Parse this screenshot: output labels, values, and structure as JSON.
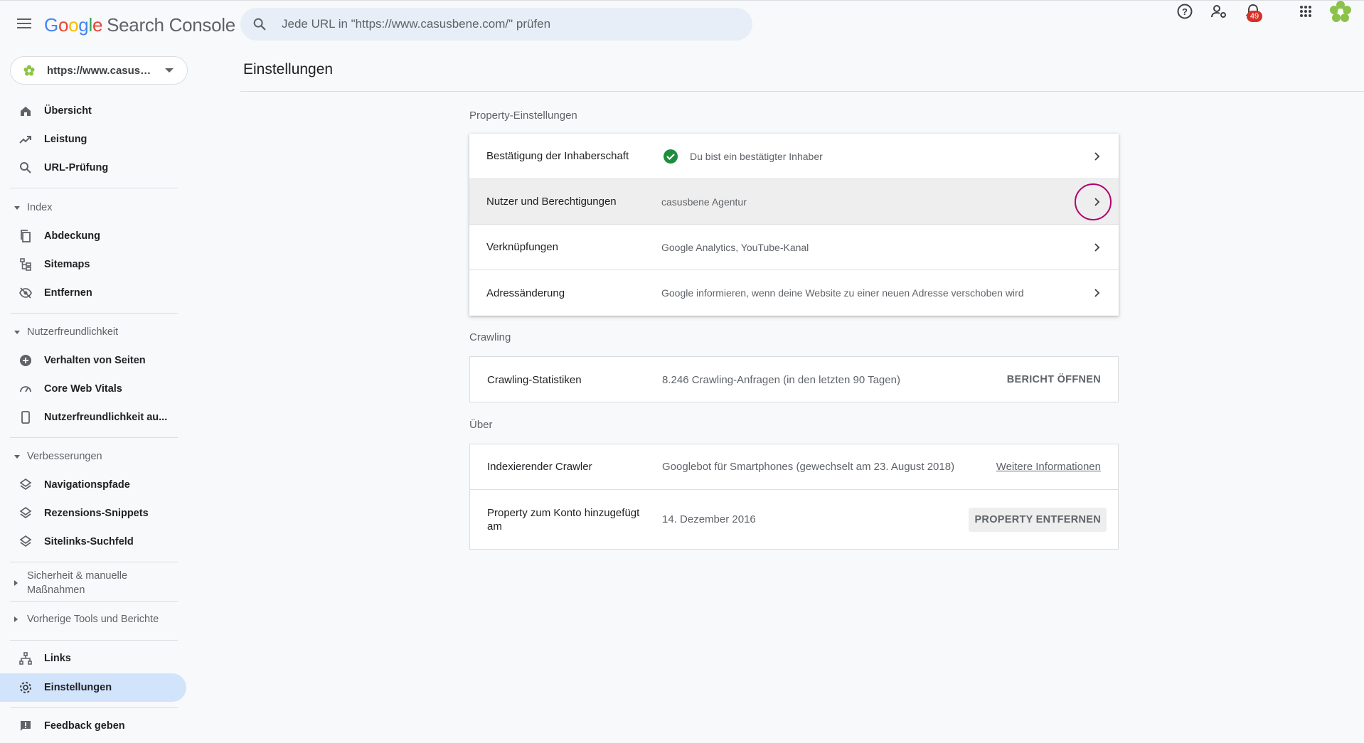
{
  "header": {
    "logo_google": [
      "G",
      "o",
      "o",
      "g",
      "l",
      "e"
    ],
    "product_name": "Search Console",
    "search_placeholder": "Jede URL in \"https://www.casusbene.com/\" prüfen",
    "notification_count": "49"
  },
  "sidebar": {
    "property": "https://www.casusbene.com/",
    "items_top": [
      {
        "label": "Übersicht",
        "icon": "home-icon"
      },
      {
        "label": "Leistung",
        "icon": "trending-up-icon"
      },
      {
        "label": "URL-Prüfung",
        "icon": "search-icon"
      }
    ],
    "group_index": "Index",
    "items_index": [
      {
        "label": "Abdeckung",
        "icon": "file-copy-icon"
      },
      {
        "label": "Sitemaps",
        "icon": "sitemap-icon"
      },
      {
        "label": "Entfernen",
        "icon": "visibility-off-icon"
      }
    ],
    "group_usability": "Nutzerfreundlichkeit",
    "items_usability": [
      {
        "label": "Verhalten von Seiten",
        "icon": "add-circle-icon"
      },
      {
        "label": "Core Web Vitals",
        "icon": "speed-icon"
      },
      {
        "label": "Nutzerfreundlichkeit au...",
        "icon": "smartphone-icon"
      }
    ],
    "group_enhancements": "Verbesserungen",
    "items_enhancements": [
      {
        "label": "Navigationspfade",
        "icon": "layers-icon"
      },
      {
        "label": "Rezensions-Snippets",
        "icon": "layers-icon"
      },
      {
        "label": "Sitelinks-Suchfeld",
        "icon": "layers-icon"
      }
    ],
    "group_security": "Sicherheit & manuelle Maßnahmen",
    "group_legacy": "Vorherige Tools und Berichte",
    "item_links": "Links",
    "item_settings": "Einstellungen",
    "item_feedback": "Feedback geben"
  },
  "main": {
    "title": "Einstellungen",
    "property_section": "Property-Einstellungen",
    "property_rows": [
      {
        "label": "Bestätigung der Inhaberschaft",
        "value": "Du bist ein bestätigter Inhaber"
      },
      {
        "label": "Nutzer und Berechtigungen",
        "value": "casusbene Agentur"
      },
      {
        "label": "Verknüpfungen",
        "value": "Google Analytics, YouTube-Kanal"
      },
      {
        "label": "Adressänderung",
        "value": "Google informieren, wenn deine Website zu einer neuen Adresse verschoben wird"
      }
    ],
    "crawling_section": "Crawling",
    "crawling_row": {
      "label": "Crawling-Statistiken",
      "value": "8.246 Crawling-Anfragen (in den letzten 90 Tagen)",
      "action": "BERICHT ÖFFNEN"
    },
    "about_section": "Über",
    "about_rows": [
      {
        "label": "Indexierender Crawler",
        "value": "Googlebot für Smartphones (gewechselt am 23. August 2018)",
        "action": "Weitere Informationen"
      },
      {
        "label": "Property zum Konto hinzugefügt am",
        "value": "14. Dezember 2016",
        "action": "PROPERTY ENTFERNEN"
      }
    ]
  },
  "colors": {
    "accent": "#1a73e8",
    "active_nav": "#d2e3fc",
    "check_green": "#1e8e3e",
    "focus_ring": "#b0006d"
  }
}
